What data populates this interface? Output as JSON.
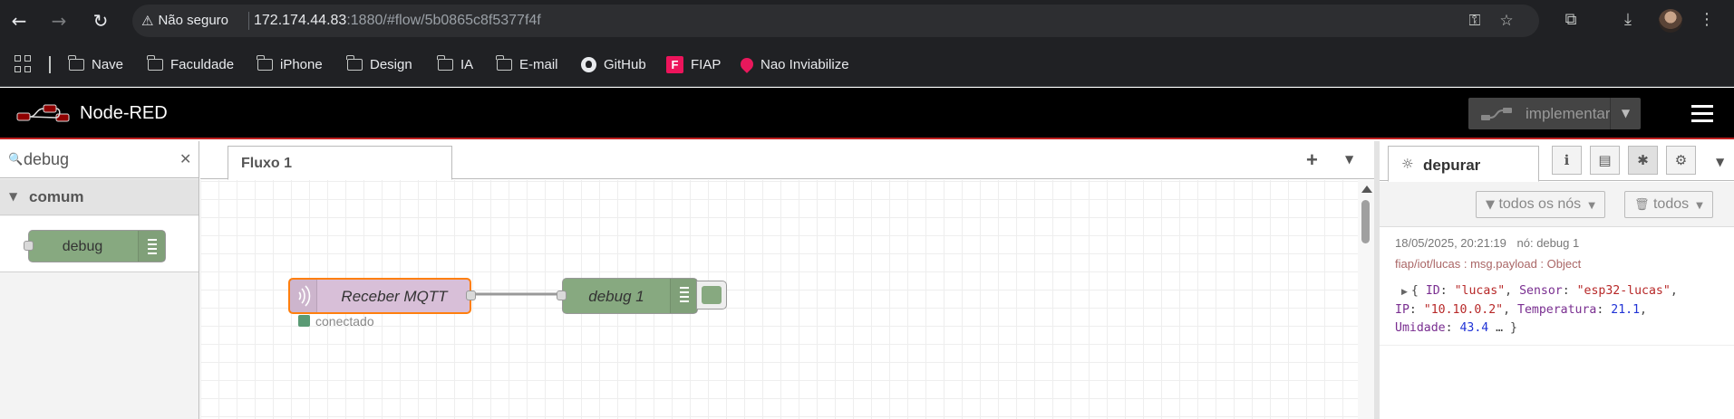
{
  "browser": {
    "security_label": "Não seguro",
    "url_host": "172.174.44.83",
    "url_rest": ":1880/#flow/5b0865c8f5377f4f",
    "bookmarks": [
      {
        "label": "Nave",
        "icon": "folder-icon"
      },
      {
        "label": "Faculdade",
        "icon": "folder-icon"
      },
      {
        "label": "iPhone",
        "icon": "folder-icon"
      },
      {
        "label": "Design",
        "icon": "folder-icon"
      },
      {
        "label": "IA",
        "icon": "folder-icon"
      },
      {
        "label": "E-mail",
        "icon": "folder-icon"
      },
      {
        "label": "GitHub",
        "icon": "github-icon"
      },
      {
        "label": "FIAP",
        "icon": "fiap-icon"
      },
      {
        "label": "Nao Inviabilize",
        "icon": "nao-inviabilize-icon"
      }
    ]
  },
  "header": {
    "title": "Node-RED",
    "deploy_label": "implementar"
  },
  "palette": {
    "search_value": "debug",
    "category_label": "comum",
    "nodes": [
      {
        "label": "debug"
      }
    ]
  },
  "workspace": {
    "tabs": [
      {
        "label": "Fluxo 1"
      }
    ],
    "nodes": {
      "mqtt_in": {
        "label": "Receber MQTT",
        "status": "conectado"
      },
      "debug": {
        "label": "debug 1"
      }
    }
  },
  "sidebar": {
    "tab_label": "depurar",
    "filter_nodes_label": "todos os nós",
    "clear_label": "todos",
    "message": {
      "timestamp": "18/05/2025, 20:21:19",
      "node": "nó: debug 1",
      "topic": "fiap/iot/lucas : msg.payload : Object",
      "payload": {
        "k1": "ID",
        "v1": "\"lucas\"",
        "k2": "Sensor",
        "v2": "\"esp32-lucas\"",
        "k3": "IP",
        "v3": "\"10.10.0.2\"",
        "k4": "Temperatura",
        "v4": "21.1",
        "k5": "Umidade",
        "v5": "43.4",
        "tail": " … }"
      }
    }
  },
  "colors": {
    "chrome_bg": "#202124",
    "header_bg": "#000000",
    "header_accent": "#c02020",
    "node_mqtt": "#d8bfd8",
    "node_debug": "#87a980",
    "selection": "#ff7f0e"
  }
}
